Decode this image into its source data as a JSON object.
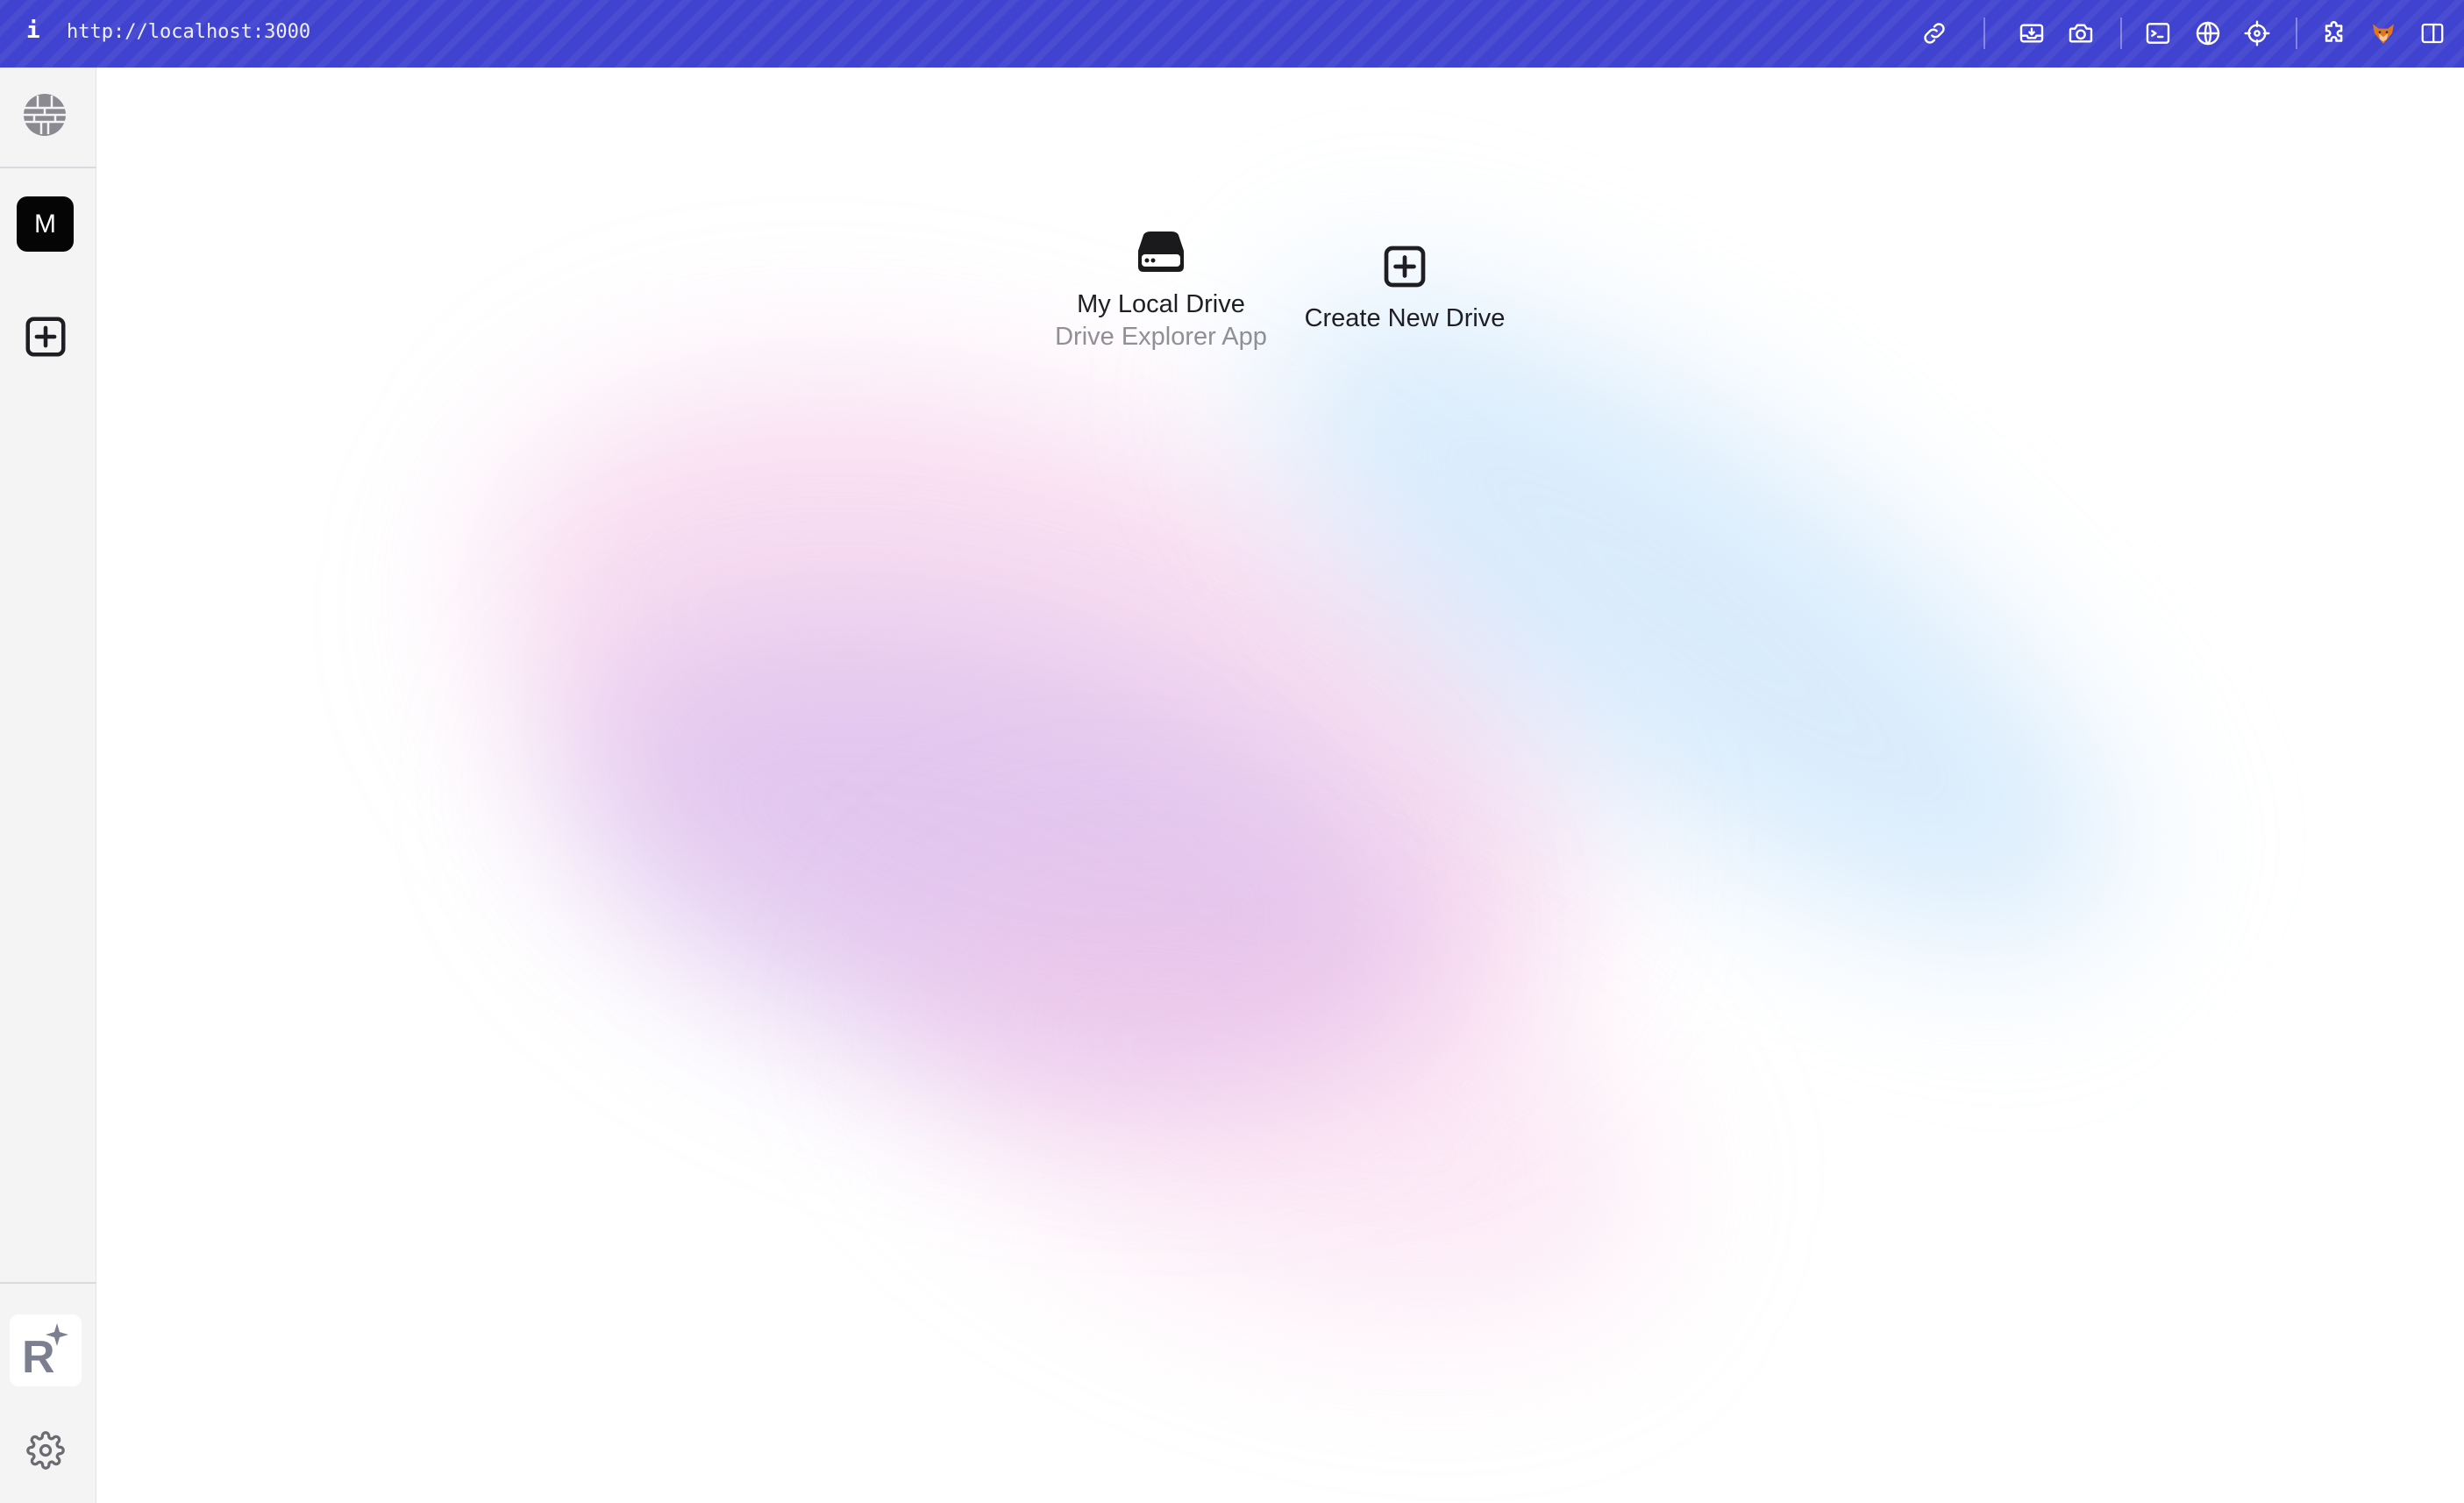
{
  "browser": {
    "info_label": "i",
    "url": "http://localhost:3000",
    "toolbar_icons": [
      "link-icon",
      "inbox-download-icon",
      "camera-icon",
      "terminal-icon",
      "globe-icon",
      "crosshair-icon",
      "extensions-icon",
      "fox-icon",
      "sidebar-toggle-icon"
    ],
    "accent_color": "#4043cf"
  },
  "sidebar": {
    "top_icon": "globe-icon",
    "drive_avatar_letter": "M",
    "add_drive_icon": "plus-square-icon",
    "assistant_logo_letter": "R",
    "settings_icon": "gear-icon"
  },
  "main": {
    "drives": [
      {
        "name": "My Local Drive",
        "subtitle": "Drive Explorer App",
        "icon": "hard-drive-icon"
      },
      {
        "name": "Create New Drive",
        "subtitle": "",
        "icon": "plus-square-icon"
      }
    ]
  }
}
